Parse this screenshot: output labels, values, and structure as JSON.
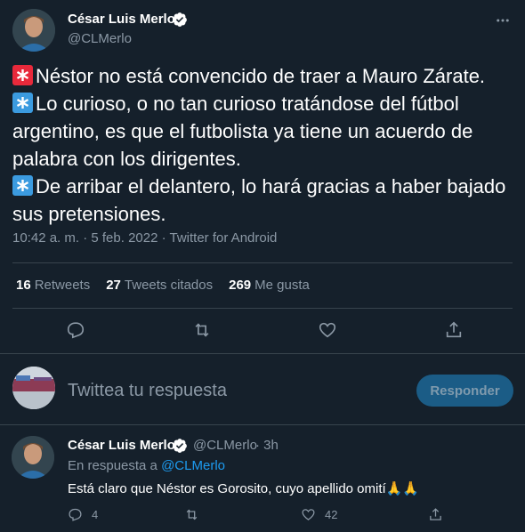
{
  "tweet": {
    "author_name": "César Luis Merlo",
    "author_handle": "@CLMerlo",
    "lines": [
      {
        "emoji": "red",
        "text": "Néstor no está convencido de traer a Mauro Zárate."
      },
      {
        "emoji": "blue",
        "text": "Lo curioso, o no tan curioso tratándose del fútbol argentino, es que el futbolista ya tiene un acuerdo de palabra con los dirigentes."
      },
      {
        "emoji": "blue",
        "text": "De arribar el delantero, lo hará gracias a haber bajado sus pretensiones."
      }
    ],
    "timestamp": "10:42 a. m. · 5 feb. 2022 · Twitter for Android"
  },
  "stats": {
    "retweets_count": "16",
    "retweets_label": "Retweets",
    "quotes_count": "27",
    "quotes_label": "Tweets citados",
    "likes_count": "269",
    "likes_label": "Me gusta"
  },
  "compose": {
    "placeholder": "Twittea tu respuesta",
    "button_label": "Responder"
  },
  "reply": {
    "author_name": "César Luis Merlo",
    "author_handle": "@CLMerlo",
    "time": "· 3h",
    "in_reply_prefix": "En respuesta a",
    "in_reply_mention": "@CLMerlo",
    "text": "Está claro que Néstor es Gorosito, cuyo apellido omití",
    "emoji": "🙏🙏",
    "reply_count": "4",
    "like_count": "42"
  },
  "colors": {
    "background": "#15202b",
    "accent": "#1d9bf0",
    "secondary_text": "#8b98a5",
    "divider": "#38444d"
  }
}
